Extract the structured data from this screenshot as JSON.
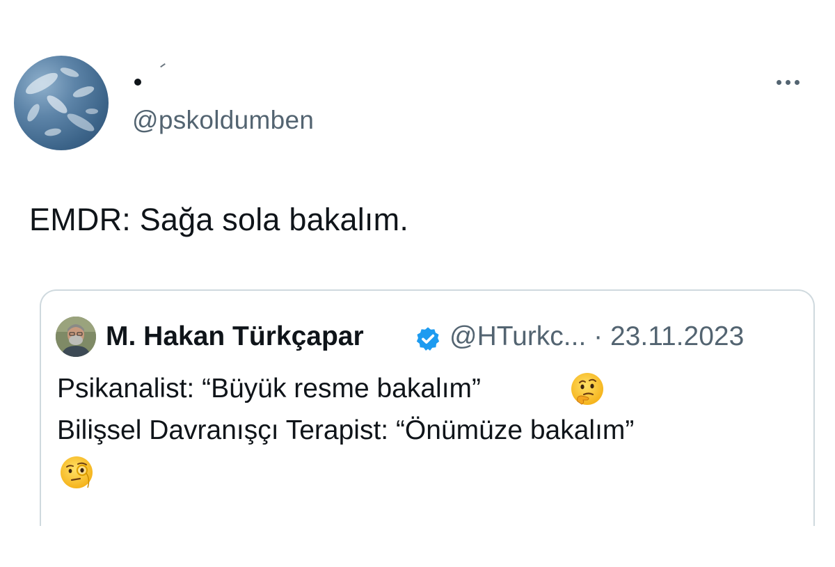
{
  "tweet": {
    "author_handle": "@pskoldumben",
    "text": "EMDR: Sağa sola bakalım.",
    "avatar_icon": "sky-clouds-avatar",
    "more_icon": "more-horizontal-icon"
  },
  "quoted_tweet": {
    "author_name": "M. Hakan Türkçapar",
    "verified_icon": "verified-badge-icon",
    "verified_color": "#1d9bf0",
    "meta": "@HTurkc... · 23.11.2023",
    "line1": "Psikanalist: “Büyük resme bakalım”",
    "line1_emoji": "thinking-face",
    "line2": "Bilişsel Davranışçı Terapist: “Önümüze bakalım”",
    "line2_emoji": "face-with-monocle"
  }
}
